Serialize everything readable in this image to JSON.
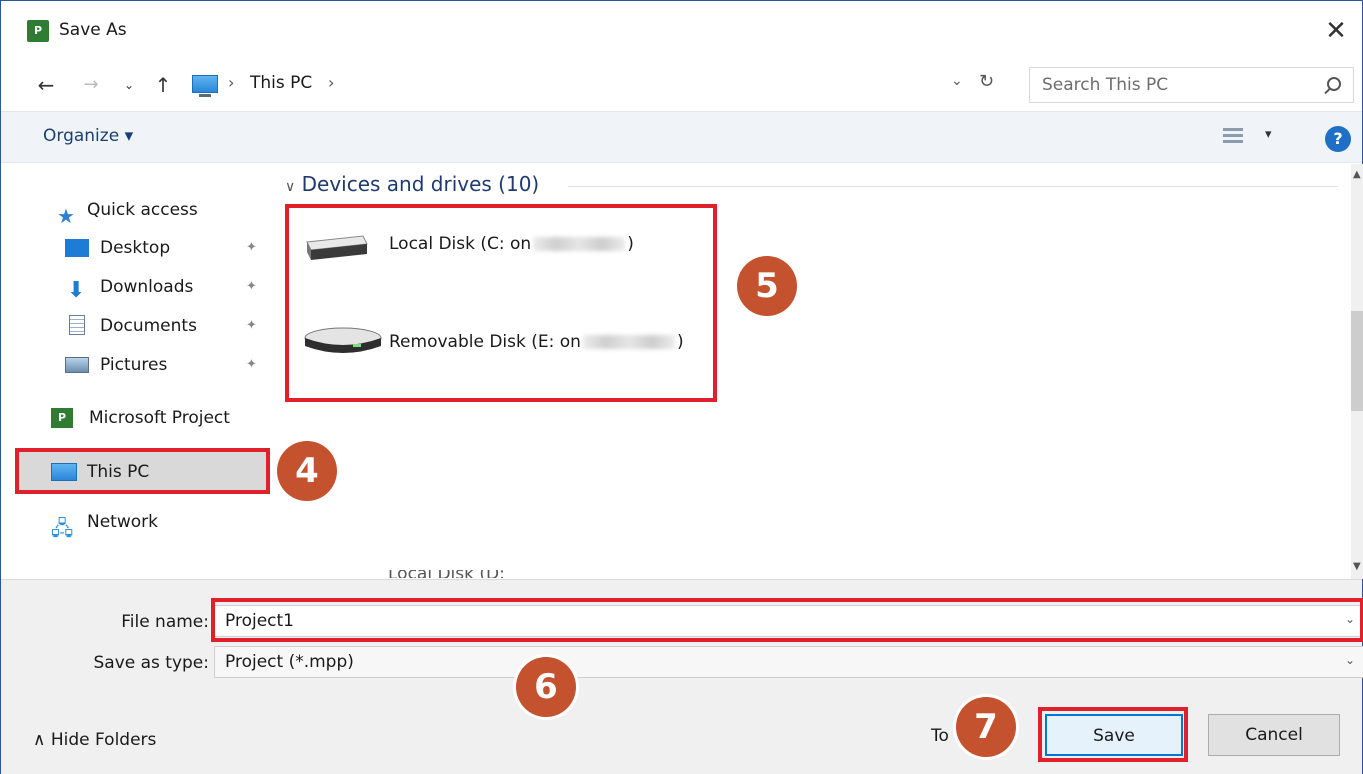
{
  "window": {
    "title": "Save As",
    "app_icon": "P",
    "close": "✕"
  },
  "nav": {
    "back": "←",
    "forward": "→",
    "recent": "⌄",
    "up": "↑",
    "breadcrumb": [
      "This PC"
    ],
    "separator": "›",
    "refresh": "↻",
    "dropdown": "⌄",
    "search_placeholder": "Search This PC"
  },
  "toolbar": {
    "organize": "Organize ▾",
    "view_dropdown": "▾",
    "help": "?"
  },
  "sidebar": {
    "items": [
      {
        "label": "Quick access",
        "icon": "star-icon"
      },
      {
        "label": "Desktop",
        "icon": "desktop-icon",
        "pinned": true
      },
      {
        "label": "Downloads",
        "icon": "download-icon",
        "pinned": true
      },
      {
        "label": "Documents",
        "icon": "document-icon",
        "pinned": true
      },
      {
        "label": "Pictures",
        "icon": "pictures-icon",
        "pinned": true
      },
      {
        "label": "Microsoft Project",
        "icon": "project-icon"
      },
      {
        "label": "This PC",
        "icon": "pc-icon",
        "selected": true
      },
      {
        "label": "Network",
        "icon": "network-icon"
      }
    ],
    "pin_glyph": "📌"
  },
  "content": {
    "group_header": "Devices and drives (10)",
    "group_chevron": "∨",
    "drives": [
      {
        "label_prefix": "Local Disk (C: on",
        "label_suffix": ")",
        "icon": "hard-disk-icon"
      },
      {
        "label_prefix": "Removable Disk (E: on",
        "label_suffix": ")",
        "icon": "removable-disk-icon"
      }
    ]
  },
  "form": {
    "file_name_label": "File name:",
    "file_name_value": "Project1",
    "save_type_label": "Save as type:",
    "save_type_value": "Project (*.mpp)",
    "dropdown_glyph": "⌄"
  },
  "footer": {
    "hide_folders": "∧  Hide Folders",
    "tools_partial": "To",
    "save": "Save",
    "cancel": "Cancel"
  },
  "annotations": {
    "step4": "4",
    "step5": "5",
    "step6": "6",
    "step7": "7",
    "highlight_color": "#e0212b",
    "badge_color": "#c4522e"
  }
}
